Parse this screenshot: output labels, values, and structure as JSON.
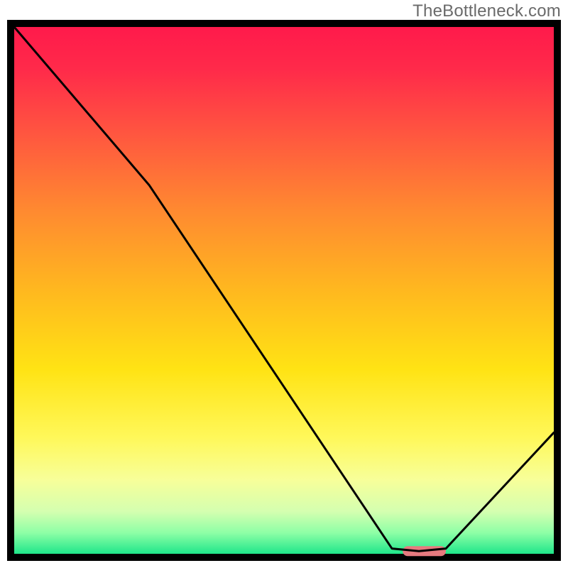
{
  "watermark": "TheBottleneck.com",
  "chart_data": {
    "type": "line",
    "title": "",
    "xlabel": "",
    "ylabel": "",
    "xlim": [
      0,
      100
    ],
    "ylim": [
      0,
      100
    ],
    "grid": false,
    "axes_visible": false,
    "series": [
      {
        "name": "bottleneck-curve",
        "x": [
          0,
          25,
          70,
          75,
          80,
          100
        ],
        "values": [
          100,
          70,
          1,
          0.5,
          1,
          23
        ]
      }
    ],
    "marker": {
      "name": "highlight-range",
      "x_start": 72,
      "x_end": 80,
      "y": 0.5,
      "color": "#e77a7f"
    },
    "gradient_stops": [
      {
        "offset": 0.0,
        "color": "#ff1a4b"
      },
      {
        "offset": 0.08,
        "color": "#ff2a4a"
      },
      {
        "offset": 0.2,
        "color": "#ff5540"
      },
      {
        "offset": 0.35,
        "color": "#ff8a30"
      },
      {
        "offset": 0.5,
        "color": "#ffb81f"
      },
      {
        "offset": 0.65,
        "color": "#ffe314"
      },
      {
        "offset": 0.78,
        "color": "#fff85a"
      },
      {
        "offset": 0.86,
        "color": "#f7ff9a"
      },
      {
        "offset": 0.92,
        "color": "#d4ffb0"
      },
      {
        "offset": 0.96,
        "color": "#8effa6"
      },
      {
        "offset": 1.0,
        "color": "#1fe68a"
      }
    ],
    "border_color": "#000000",
    "line_color": "#000000",
    "line_width": 3
  }
}
